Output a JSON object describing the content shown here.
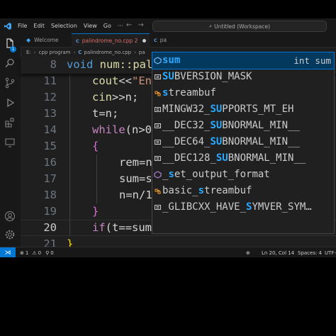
{
  "titlebar": {
    "menu": [
      "File",
      "Edit",
      "Selection",
      "View",
      "Go",
      "···"
    ],
    "search_text": "Untitled (Workspace)"
  },
  "activity": {
    "icons": [
      "files-icon",
      "search-icon",
      "source-control-icon",
      "run-debug-icon",
      "extensions-icon",
      "remote-explorer-icon",
      "account-icon",
      "manage-gear-icon"
    ],
    "explorer_badge": "1"
  },
  "tabs": [
    {
      "label": "Welcome",
      "active": false
    },
    {
      "label": "palindrome_no.cpp 2",
      "icon_text": "C",
      "active": true
    },
    {
      "label": "pa",
      "icon_text": "C",
      "active": false
    }
  ],
  "breadcrumb": [
    "E:",
    "cpp program",
    "palindrome_no.cpp",
    "pa"
  ],
  "editor": {
    "lines": [
      {
        "num": "8",
        "sticky": true
      },
      {
        "num": "11"
      },
      {
        "num": "12"
      },
      {
        "num": "13"
      },
      {
        "num": "14"
      },
      {
        "num": "15"
      },
      {
        "num": "16"
      },
      {
        "num": "17"
      },
      {
        "num": "18"
      },
      {
        "num": "19"
      },
      {
        "num": "20",
        "current": true
      },
      {
        "num": "21"
      }
    ],
    "code": {
      "l8_kw": "void",
      "l8_name": "num::pal",
      "l11_fn": "cout",
      "l11_op": "<<",
      "l11_str": "\"En",
      "l12_fn": "cin",
      "l12_rest": ">>n;",
      "l13": "t=n;",
      "l14_kw": "while",
      "l14_rest": "(n>0",
      "l15": "{",
      "l16": "rem=n",
      "l17": "sum=s",
      "l18": "n=n/1",
      "l19": "}",
      "l20_kw": "if",
      "l20_rest": "(t==sum)",
      "l21": "}"
    }
  },
  "suggest": {
    "items": [
      {
        "pre": "",
        "hl": "sum",
        "post": "",
        "detail": "int sum",
        "icon": "field-icon",
        "selected": true
      },
      {
        "pre": "",
        "hl": "SU",
        "post": "BVERSION_MASK",
        "icon": "constant-icon"
      },
      {
        "pre": "",
        "hl": "s",
        "post": "treambuf",
        "icon": "class-icon"
      },
      {
        "pre": "MINGW32_",
        "hl": "SU",
        "post": "PPORTS_MT_EH",
        "icon": "constant-icon"
      },
      {
        "pre": "__DEC32_",
        "hl": "SU",
        "post": "BNORMAL_MIN__",
        "icon": "constant-icon"
      },
      {
        "pre": "__DEC64_",
        "hl": "SU",
        "post": "BNORMAL_MIN__",
        "icon": "constant-icon"
      },
      {
        "pre": "__DEC128_",
        "hl": "SU",
        "post": "BNORMAL_MIN__",
        "icon": "constant-icon"
      },
      {
        "pre": "_",
        "hl": "s",
        "post": "et_output_format",
        "icon": "function-icon"
      },
      {
        "pre": "basic_",
        "hl": "s",
        "post": "treambuf",
        "icon": "class-icon"
      },
      {
        "pre": "_GLIBCXX_HAVE_",
        "hl": "S",
        "post": "YMVER_SYM…",
        "icon": "constant-icon"
      }
    ]
  },
  "statusbar": {
    "errors": "1",
    "warnings": "0",
    "ports": "0",
    "position": "Ln 20, Col 14",
    "spaces": "Spaces: 4",
    "encoding": "UTF-"
  },
  "colors": {
    "accent": "#0078d4",
    "keyword": "#569cd6",
    "control": "#c586c0",
    "function": "#dcdcaa",
    "variable": "#9cdcfe",
    "string": "#ce9178",
    "match_highlight": "#2aaaff"
  }
}
